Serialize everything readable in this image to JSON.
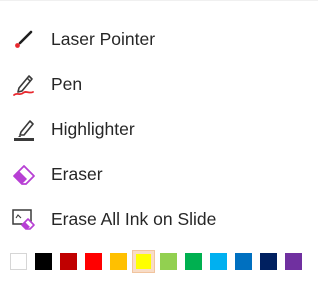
{
  "menu": {
    "items": [
      {
        "label": "Laser Pointer",
        "icon": "laser-pointer-icon"
      },
      {
        "label": "Pen",
        "icon": "pen-icon"
      },
      {
        "label": "Highlighter",
        "icon": "highlighter-icon"
      },
      {
        "label": "Eraser",
        "icon": "eraser-icon"
      },
      {
        "label": "Erase All Ink on Slide",
        "icon": "erase-all-ink-icon"
      }
    ]
  },
  "palette": {
    "selected": "#ffff00",
    "colors": [
      "#ffffff",
      "#000000",
      "#c00000",
      "#ff0000",
      "#ffc000",
      "#ffff00",
      "#92d050",
      "#00b050",
      "#00b0f0",
      "#0070c0",
      "#002060",
      "#7030a0"
    ]
  },
  "colors": {
    "text": "#262626",
    "accent_pen": "#e8282e",
    "eraser": "#b73fd4",
    "selection_bg": "#f8dcc7"
  }
}
